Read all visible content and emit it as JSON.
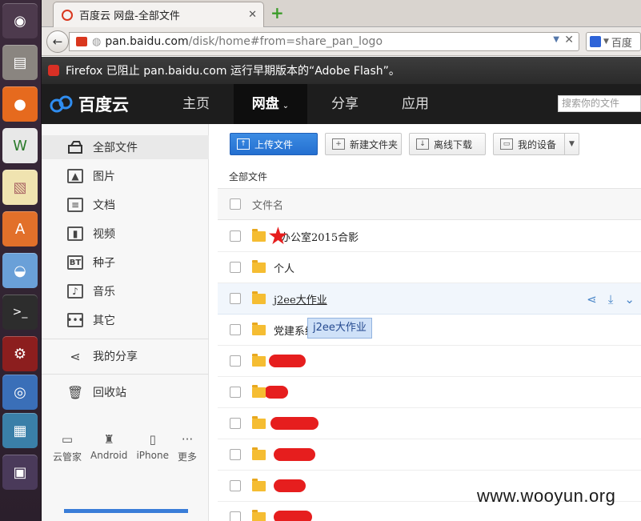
{
  "launcher": {
    "apps": [
      "ubuntu-dash",
      "files",
      "firefox",
      "libreoffice-writer",
      "document-viewer",
      "software-center",
      "remmina",
      "terminal",
      "system-settings",
      "chromium",
      "screenshot",
      "workspaces"
    ]
  },
  "browser": {
    "tab_title": "百度云 网盘-全部文件",
    "url_host": "pan.baidu.com",
    "url_path": "/disk/home#from=share_pan_logo",
    "search_engine_label": "百度",
    "flash_notice": "Firefox 已阻止 pan.baidu.com 运行早期版本的“Adobe Flash”。"
  },
  "header": {
    "logo_text": "百度云",
    "nav": [
      {
        "label": "主页"
      },
      {
        "label": "网盘"
      },
      {
        "label": "分享"
      },
      {
        "label": "应用"
      }
    ],
    "search_placeholder": "搜索你的文件"
  },
  "sidebar": {
    "items": [
      {
        "label": "全部文件",
        "icon": "all-files-icon"
      },
      {
        "label": "图片",
        "icon": "image-icon"
      },
      {
        "label": "文档",
        "icon": "document-icon"
      },
      {
        "label": "视频",
        "icon": "video-icon"
      },
      {
        "label": "种子",
        "icon": "torrent-icon"
      },
      {
        "label": "音乐",
        "icon": "music-icon"
      },
      {
        "label": "其它",
        "icon": "other-icon"
      },
      {
        "label": "我的分享",
        "icon": "share-icon"
      },
      {
        "label": "回收站",
        "icon": "trash-icon"
      }
    ],
    "torrent_badge": "BT",
    "devices": [
      {
        "label": "云管家"
      },
      {
        "label": "Android"
      },
      {
        "label": "iPhone"
      },
      {
        "label": "更多"
      }
    ],
    "quota_fraction": 1.0
  },
  "toolbar": {
    "upload_label": "上传文件",
    "new_folder_label": "新建文件夹",
    "offline_download_label": "离线下载",
    "my_devices_label": "我的设备"
  },
  "breadcrumb": "全部文件",
  "list": {
    "header_label": "文件名",
    "rows": [
      {
        "name": "办公室2015合影"
      },
      {
        "name": "个人"
      },
      {
        "name": "j2ee大作业"
      },
      {
        "name": "党建系统"
      },
      {
        "name": ""
      },
      {
        "name": ""
      },
      {
        "name": ""
      },
      {
        "name": ""
      },
      {
        "name": ""
      },
      {
        "name": ""
      }
    ]
  },
  "tooltip": "j2ee大作业",
  "watermark": "www.wooyun.org",
  "colors": {
    "accent": "#246fd0",
    "header_bg": "#1d1d1d",
    "folder": "#f5bd32",
    "redaction": "#e61e1e"
  }
}
